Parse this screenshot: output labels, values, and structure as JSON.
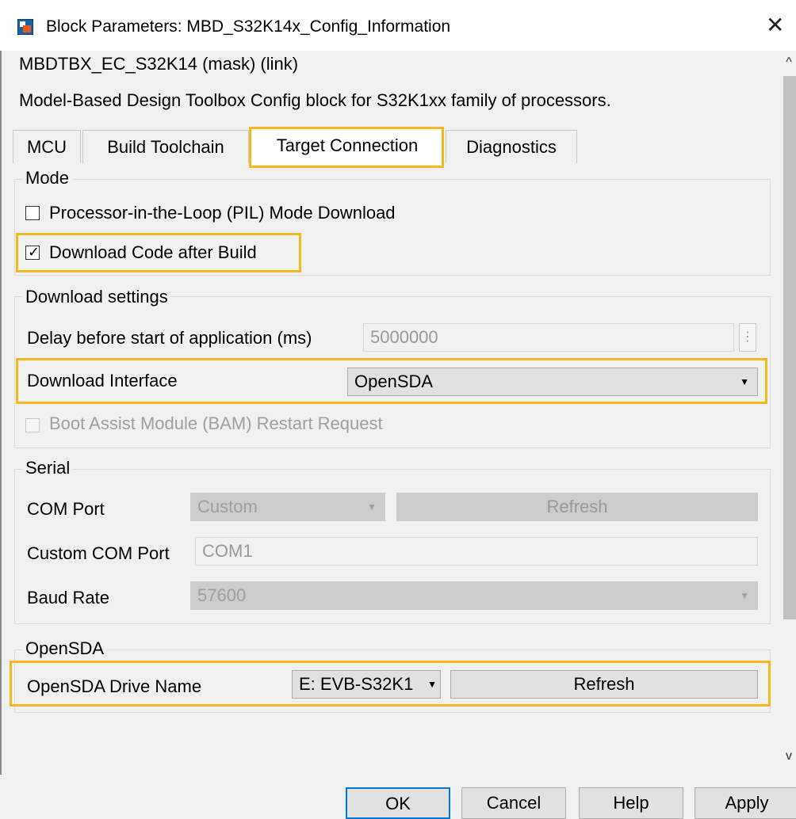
{
  "window": {
    "title": "Block Parameters: MBD_S32K14x_Config_Information"
  },
  "header": {
    "mask_title": "MBDTBX_EC_S32K14 (mask) (link)",
    "description": "Model-Based Design Toolbox Config block for S32K1xx family of processors."
  },
  "tabs": [
    {
      "label": "MCU"
    },
    {
      "label": "Build Toolchain"
    },
    {
      "label": "Target Connection",
      "selected": true
    },
    {
      "label": "Diagnostics"
    }
  ],
  "mode": {
    "group_label": "Mode",
    "pil_label": "Processor-in-the-Loop (PIL) Mode Download",
    "pil_checked": false,
    "download_code_label": "Download Code after Build",
    "download_code_checked": true,
    "check_glyph": "✓"
  },
  "download_settings": {
    "group_label": "Download settings",
    "delay_label": "Delay before start of application (ms)",
    "delay_value": "5000000",
    "interface_label": "Download Interface",
    "interface_value": "OpenSDA",
    "bam_label": "Boot Assist Module (BAM) Restart Request",
    "bam_checked": false
  },
  "serial": {
    "group_label": "Serial",
    "com_port_label": "COM Port",
    "com_port_value": "Custom",
    "refresh_label": "Refresh",
    "custom_com_label": "Custom COM Port",
    "custom_com_value": "COM1",
    "baud_label": "Baud Rate",
    "baud_value": "57600"
  },
  "opensda": {
    "group_label": "OpenSDA",
    "drive_label": "OpenSDA Drive Name",
    "drive_value": "E: EVB-S32K1",
    "refresh_label": "Refresh"
  },
  "footer": {
    "ok": "OK",
    "cancel": "Cancel",
    "help": "Help",
    "apply": "Apply"
  },
  "colors": {
    "highlight": "#f5b81c",
    "focus_border": "#0078d7"
  },
  "icons": [
    "matlab-block-icon",
    "close-icon",
    "scroll-up-icon",
    "scroll-down-icon",
    "dropdown-arrow-icon"
  ]
}
